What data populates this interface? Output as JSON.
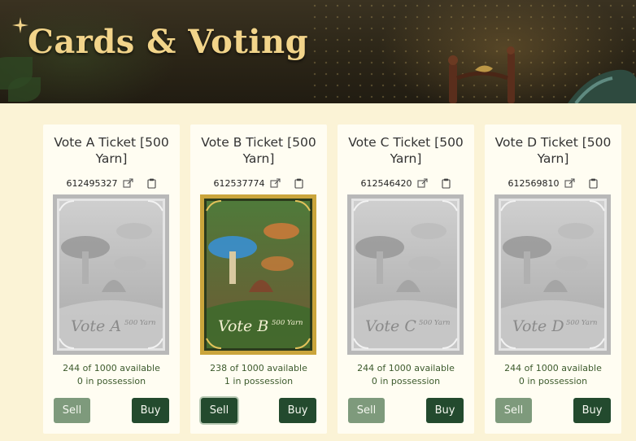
{
  "header": {
    "title": "Cards & Voting"
  },
  "cards": [
    {
      "title": "Vote A Ticket [500 Yarn]",
      "id": "612495327",
      "available": "244 of 1000 available",
      "possession": "0 in possession",
      "sell_label": "Sell",
      "buy_label": "Buy",
      "art_label": "Vote A",
      "art_price": "500 Yarn",
      "active": false
    },
    {
      "title": "Vote B Ticket [500 Yarn]",
      "id": "612537774",
      "available": "238 of 1000 available",
      "possession": "1 in possession",
      "sell_label": "Sell",
      "buy_label": "Buy",
      "art_label": "Vote B",
      "art_price": "500 Yarn",
      "active": true
    },
    {
      "title": "Vote C Ticket [500 Yarn]",
      "id": "612546420",
      "available": "244 of 1000 available",
      "possession": "0 in possession",
      "sell_label": "Sell",
      "buy_label": "Buy",
      "art_label": "Vote C",
      "art_price": "500 Yarn",
      "active": false
    },
    {
      "title": "Vote D Ticket [500 Yarn]",
      "id": "612569810",
      "available": "244 of 1000 available",
      "possession": "0 in possession",
      "sell_label": "Sell",
      "buy_label": "Buy",
      "art_label": "Vote D",
      "art_price": "500 Yarn",
      "active": false
    }
  ],
  "colors": {
    "accent": "#234a2e",
    "muted": "#7e9a7c",
    "background": "#fbf3d6",
    "title": "#f2d48a"
  },
  "icons": {
    "external_link": "external-link-icon",
    "clipboard": "clipboard-icon",
    "sparkle": "sparkle-icon"
  }
}
